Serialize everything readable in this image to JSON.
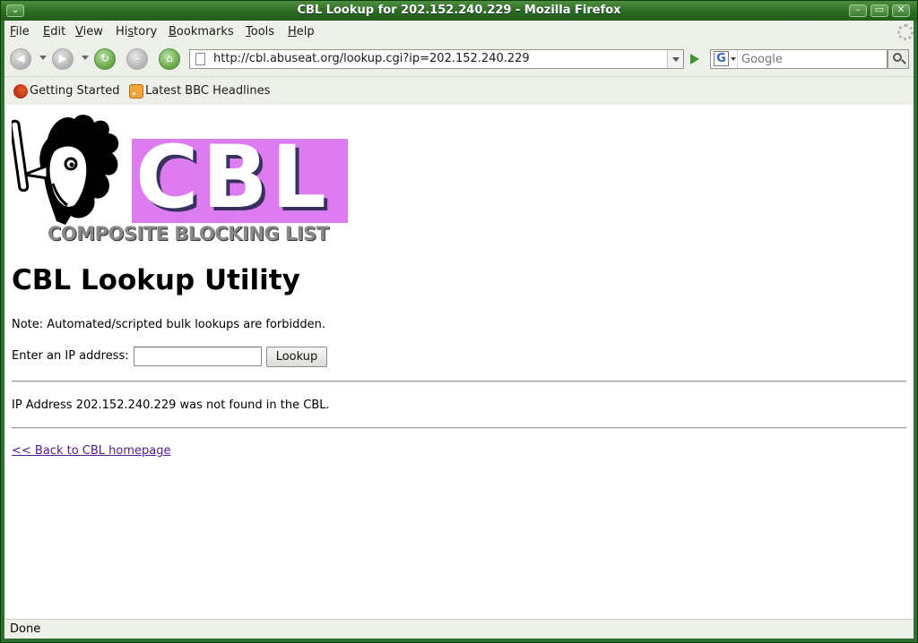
{
  "window": {
    "title": "CBL Lookup for 202.152.240.229 - Mozilla Firefox"
  },
  "menubar": {
    "items": [
      {
        "label": "File"
      },
      {
        "label": "Edit"
      },
      {
        "label": "View"
      },
      {
        "label": "History"
      },
      {
        "label": "Bookmarks"
      },
      {
        "label": "Tools"
      },
      {
        "label": "Help"
      }
    ]
  },
  "toolbar": {
    "url": "http://cbl.abuseat.org/lookup.cgi?ip=202.152.240.229",
    "search_placeholder": "Google",
    "search_engine_letter": "G"
  },
  "bookmarks": {
    "items": [
      {
        "label": "Getting Started"
      },
      {
        "label": "Latest BBC Headlines"
      }
    ]
  },
  "page": {
    "logo_text": "CBL",
    "logo_subtitle": "COMPOSITE BLOCKING LIST",
    "heading": "CBL Lookup Utility",
    "note": "Note: Automated/scripted bulk lookups are forbidden.",
    "ip_label": "Enter an IP address:",
    "ip_value": "",
    "lookup_button": "Lookup",
    "result": "IP Address 202.152.240.229 was not found in the CBL.",
    "back_link": "<< Back to CBL homepage"
  },
  "status": {
    "text": "Done"
  },
  "colors": {
    "title_bar": "#2a6a22",
    "logo_banner": "#dd7cf0",
    "visited_link": "#551a8b"
  }
}
